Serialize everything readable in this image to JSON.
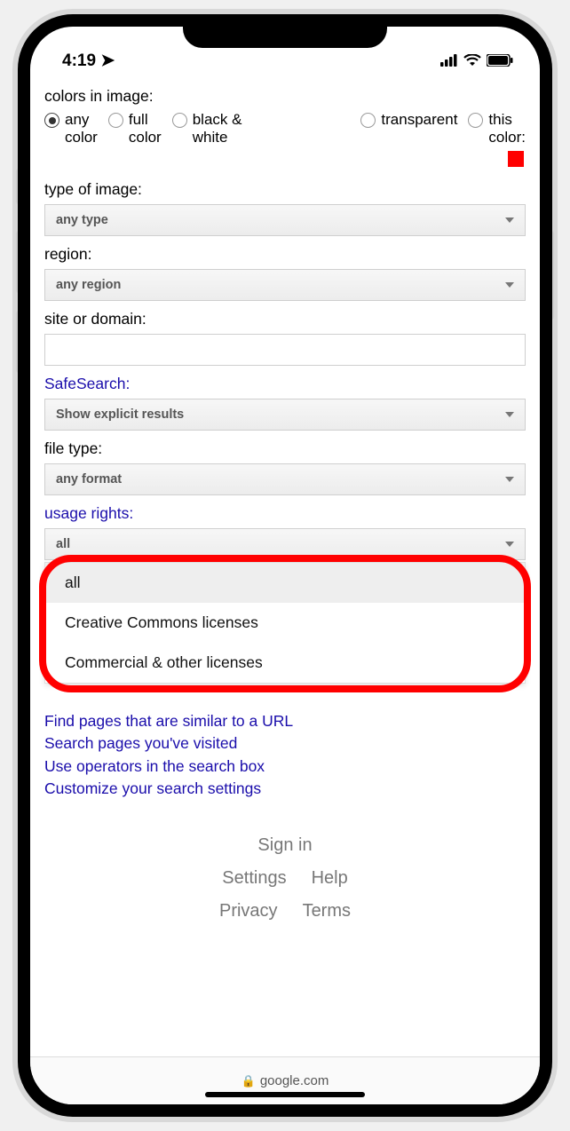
{
  "status": {
    "time": "4:19",
    "domain": "google.com"
  },
  "colors_section": {
    "label": "colors in image:",
    "options": {
      "any": "any color",
      "full": "full color",
      "bw": "black & white",
      "transparent": "transparent",
      "this": "this color:"
    },
    "selected": "any",
    "swatch_color": "#ff0000"
  },
  "type_section": {
    "label": "type of image:",
    "value": "any type"
  },
  "region_section": {
    "label": "region:",
    "value": "any region"
  },
  "site_section": {
    "label": "site or domain:",
    "value": ""
  },
  "safesearch_section": {
    "label": "SafeSearch:",
    "value": "Show explicit results"
  },
  "filetype_section": {
    "label": "file type:",
    "value": "any format"
  },
  "usage_section": {
    "label": "usage rights:",
    "value": "all",
    "options": {
      "o0": "all",
      "o1": "Creative Commons licenses",
      "o2": "Commercial & other licenses"
    }
  },
  "help_links": {
    "l0": "Find pages that are similar to a URL",
    "l1": "Search pages you've visited",
    "l2": "Use operators in the search box",
    "l3": "Customize your search settings"
  },
  "footer": {
    "signin": "Sign in",
    "settings": "Settings",
    "help": "Help",
    "privacy": "Privacy",
    "terms": "Terms"
  }
}
